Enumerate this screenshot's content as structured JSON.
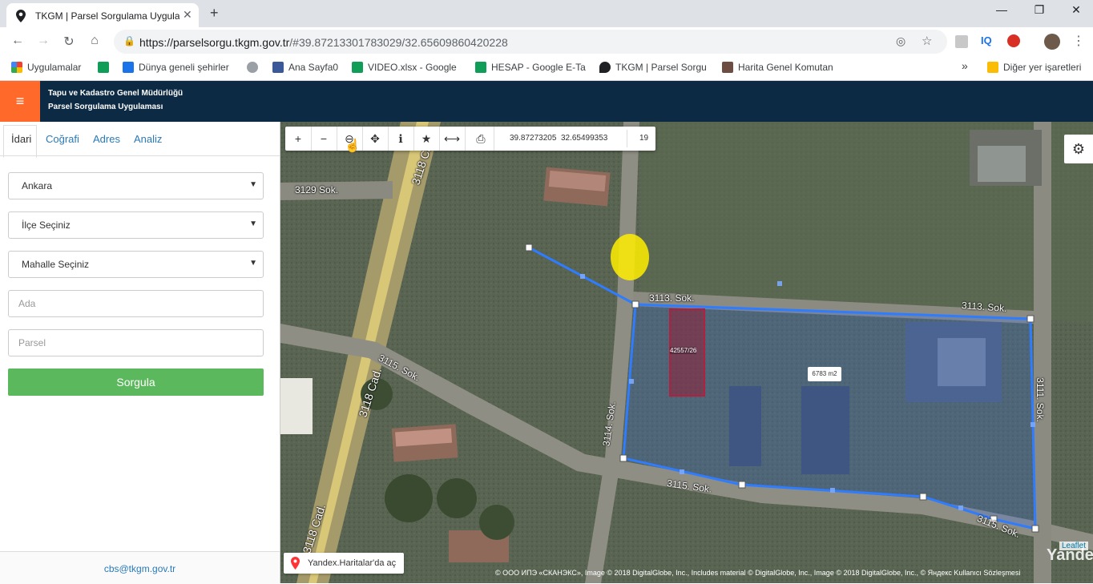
{
  "browser": {
    "tab_title": "TKGM | Parsel Sorgulama Uygula",
    "new_tab": "+",
    "url_host": "https://parselsorgu.tkgm.gov.tr",
    "url_path": "/#39.87213301783029/32.65609860420228",
    "window_controls": [
      "—",
      "❐",
      "✕"
    ],
    "bookmarks": [
      {
        "label": "Uygulamalar",
        "color": "#ea4335"
      },
      {
        "label": "Dünya geneli şehirler",
        "color": "#1a73e8"
      },
      {
        "label": "",
        "color": "#9aa0a6"
      },
      {
        "label": "Ana Sayfa0",
        "color": "#3b5998"
      },
      {
        "label": "VIDEO.xlsx - Google",
        "color": "#0f9d58"
      },
      {
        "label": "HESAP - Google E-Ta",
        "color": "#0f9d58"
      },
      {
        "label": "TKGM | Parsel Sorgu",
        "color": "#202124"
      },
      {
        "label": "Harita Genel Komutan",
        "color": "#6d4c41"
      }
    ],
    "other_bookmarks": "Diğer yer işaretleri",
    "more_bookmarks": "»"
  },
  "app": {
    "title_line1": "Tapu ve Kadastro Genel Müdürlüğü",
    "title_line2": "Parsel Sorgulama Uygulaması",
    "accent": "#ff6a2b",
    "header_bg": "#0d2a44"
  },
  "sidebar": {
    "tabs": [
      "İdari",
      "Coğrafi",
      "Adres",
      "Analiz"
    ],
    "il_value": "Ankara",
    "ilce_value": "İlçe Seçiniz",
    "mahalle_value": "Mahalle Seçiniz",
    "ada_placeholder": "Ada",
    "parsel_placeholder": "Parsel",
    "submit_label": "Sorgula",
    "footer_email": "cbs@tkgm.gov.tr"
  },
  "map": {
    "tools": [
      "+",
      "−",
      "⊖",
      "✥",
      "ℹ",
      "★",
      "⟷",
      "⎙"
    ],
    "coord_lat": "39.87273205",
    "coord_lon": "32.65499353",
    "zoom_level": "19",
    "parcel_label": "42557/26",
    "area_label": "6783 m2",
    "streets": {
      "s3129": "3129 Sok.",
      "s3118a": "3118 Cad.",
      "s3118b": "3118 Cad.",
      "s3118c": "3118 Cad.",
      "s3115a": "3115. Sok.",
      "s3115b": "3115. Sok.",
      "s3115c": "3115. Sok.",
      "s3113a": "3113. Sok.",
      "s3113b": "3113. Sok.",
      "s3114": "3114. Sok.",
      "s3111": "3111. Sok."
    },
    "yandex_button": "Yandex.Haritalar'da aç",
    "leaflet": "Leaflet",
    "attribution": "© ООО ИПЭ «СКАНЭКС», Image © 2018 DigitalGlobe, Inc., Includes material © DigitalGlobe, Inc., Image © 2018 DigitalGlobe, Inc., © Яндекс  Kullanıcı Sözleşmesi",
    "yandex_logo": "Yandex"
  }
}
